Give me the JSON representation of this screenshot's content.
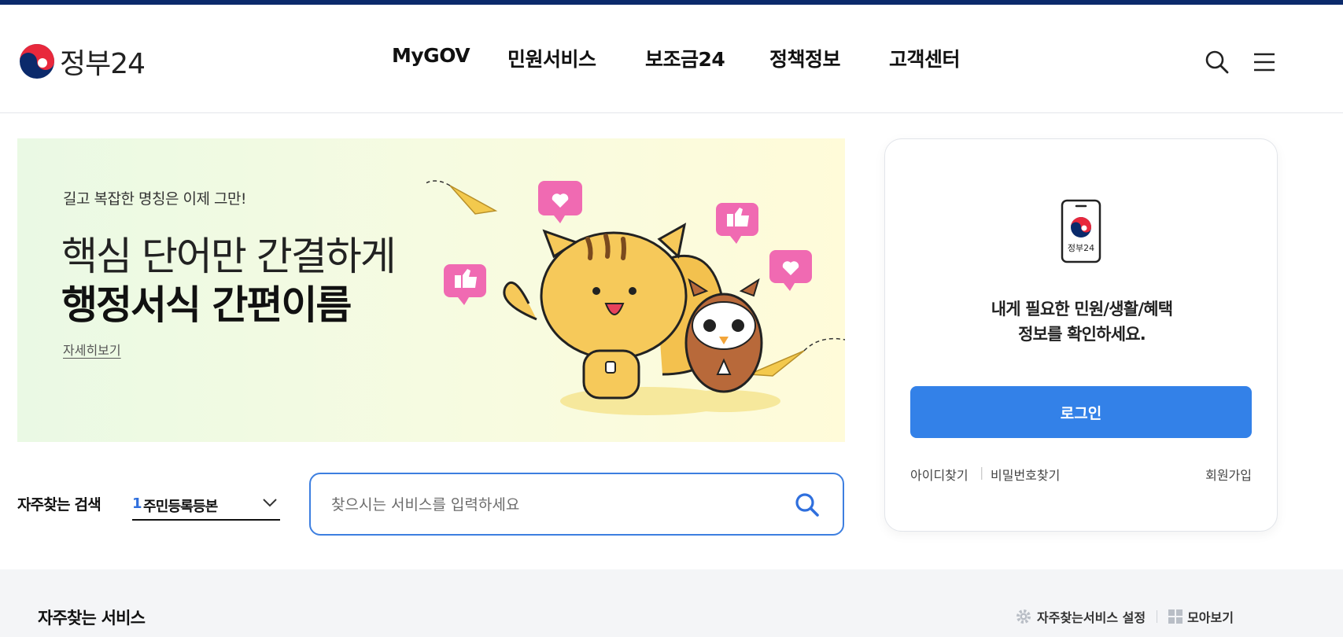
{
  "header": {
    "logo_text": "정부24",
    "nav": [
      "MyGOV",
      "민원서비스",
      "보조금24",
      "정책정보",
      "고객센터"
    ]
  },
  "banner": {
    "subtitle": "길고 복잡한 명칭은 이제 그만!",
    "headline_line1": "핵심 단어만 간결하게",
    "headline_line2": "행정서식 간편이름",
    "more_link": "자세히보기"
  },
  "login_panel": {
    "icon_label": "정부24",
    "message_line1": "내게 필요한 민원/생활/혜택",
    "message_line2": "정보를 확인하세요.",
    "login_button": "로그인",
    "find_id": "아이디찾기",
    "find_password": "비밀번호찾기",
    "separator": "|",
    "signup": "회원가입"
  },
  "frequent_search": {
    "label": "자주찾는 검색",
    "selected_rank": "1",
    "selected_value": "주민등록등본",
    "search_placeholder": "찾으시는 서비스를 입력하세요"
  },
  "frequent_services": {
    "title": "자주찾는 서비스",
    "settings_label": "자주찾는서비스 설정",
    "view_all_label": "모아보기"
  },
  "colors": {
    "brand_navy": "#0b2a6b",
    "primary_blue": "#3381e8",
    "rank_blue": "#2f6fdd"
  }
}
